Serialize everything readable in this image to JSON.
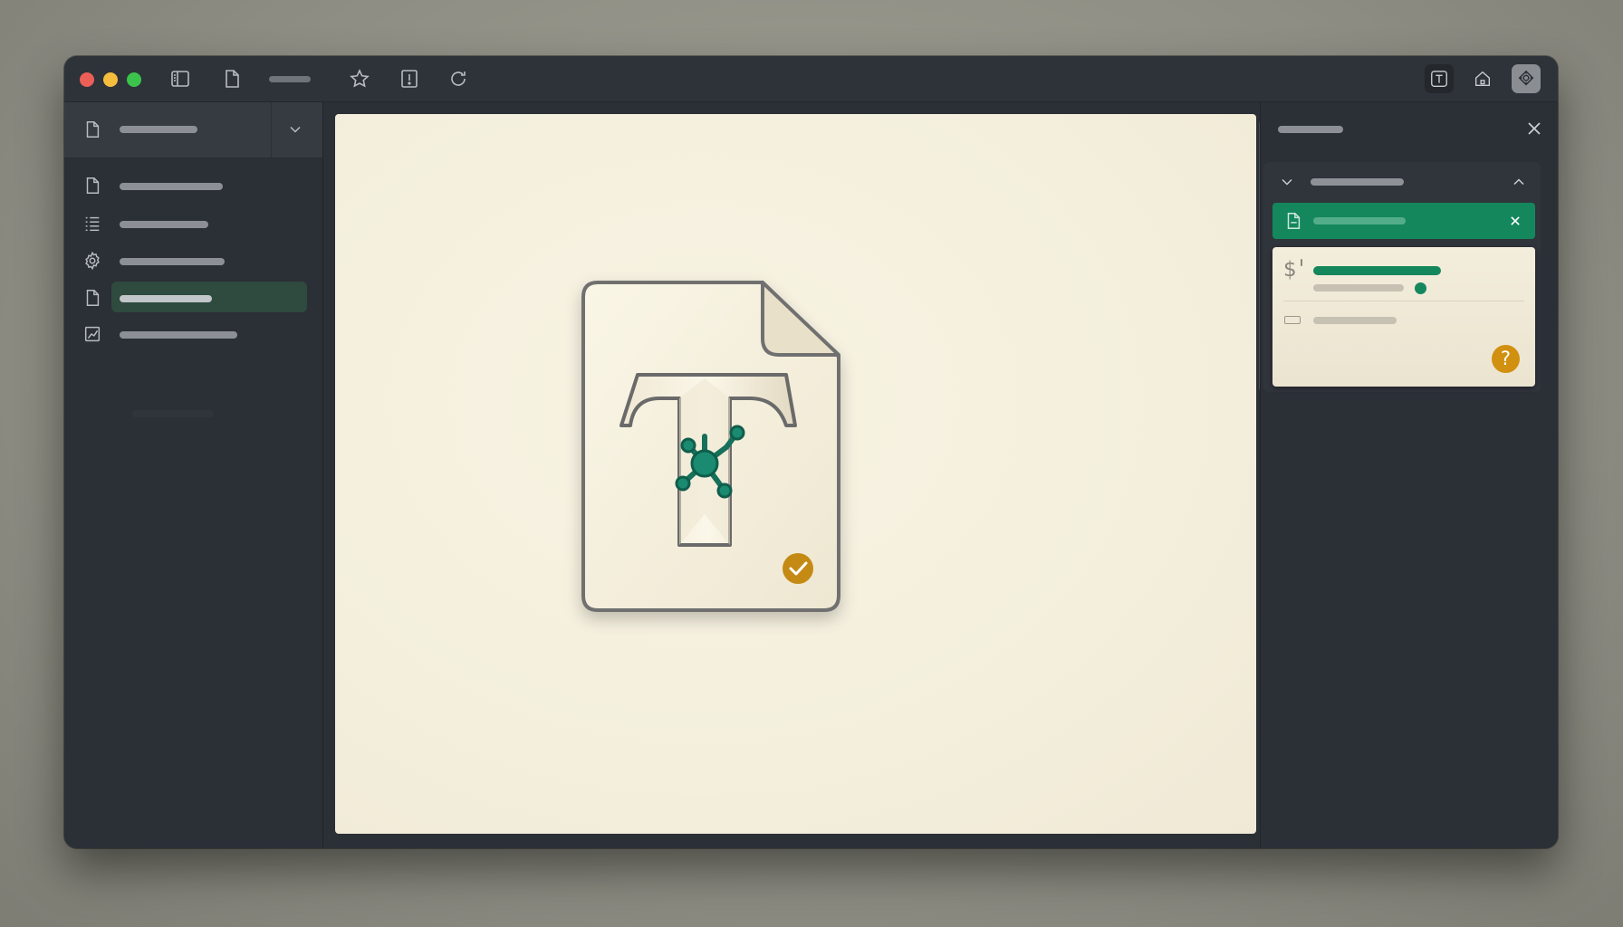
{
  "window": {
    "traffic_lights": [
      "close",
      "minimize",
      "zoom"
    ]
  },
  "toolbar": {
    "left_icons": [
      "sidebar-toggle-icon",
      "document-icon",
      "star-icon",
      "alert-icon",
      "reload-icon"
    ],
    "right_icons": [
      "text-tool-icon",
      "home-icon",
      "extension-icon"
    ]
  },
  "sidebar": {
    "header_icon": "document-icon",
    "items": [
      {
        "icon": "document-icon",
        "active": false
      },
      {
        "icon": "list-icon",
        "active": false
      },
      {
        "icon": "gear-icon",
        "active": false
      },
      {
        "icon": "document-icon",
        "active": true
      },
      {
        "icon": "chart-icon",
        "active": false
      }
    ]
  },
  "document": {
    "icon": "text-document-network-icon",
    "badge": "checkmark-badge"
  },
  "right_panel": {
    "close_icon": "close-icon",
    "group": {
      "expanded": true,
      "active_item_icon": "document-icon",
      "card": {
        "symbol": "$",
        "help_label": "?"
      }
    }
  },
  "colors": {
    "accent_green": "#14875d",
    "accent_gold": "#d1900f",
    "panel_bg": "#2b2f36",
    "page_bg": "#f4efdd"
  }
}
